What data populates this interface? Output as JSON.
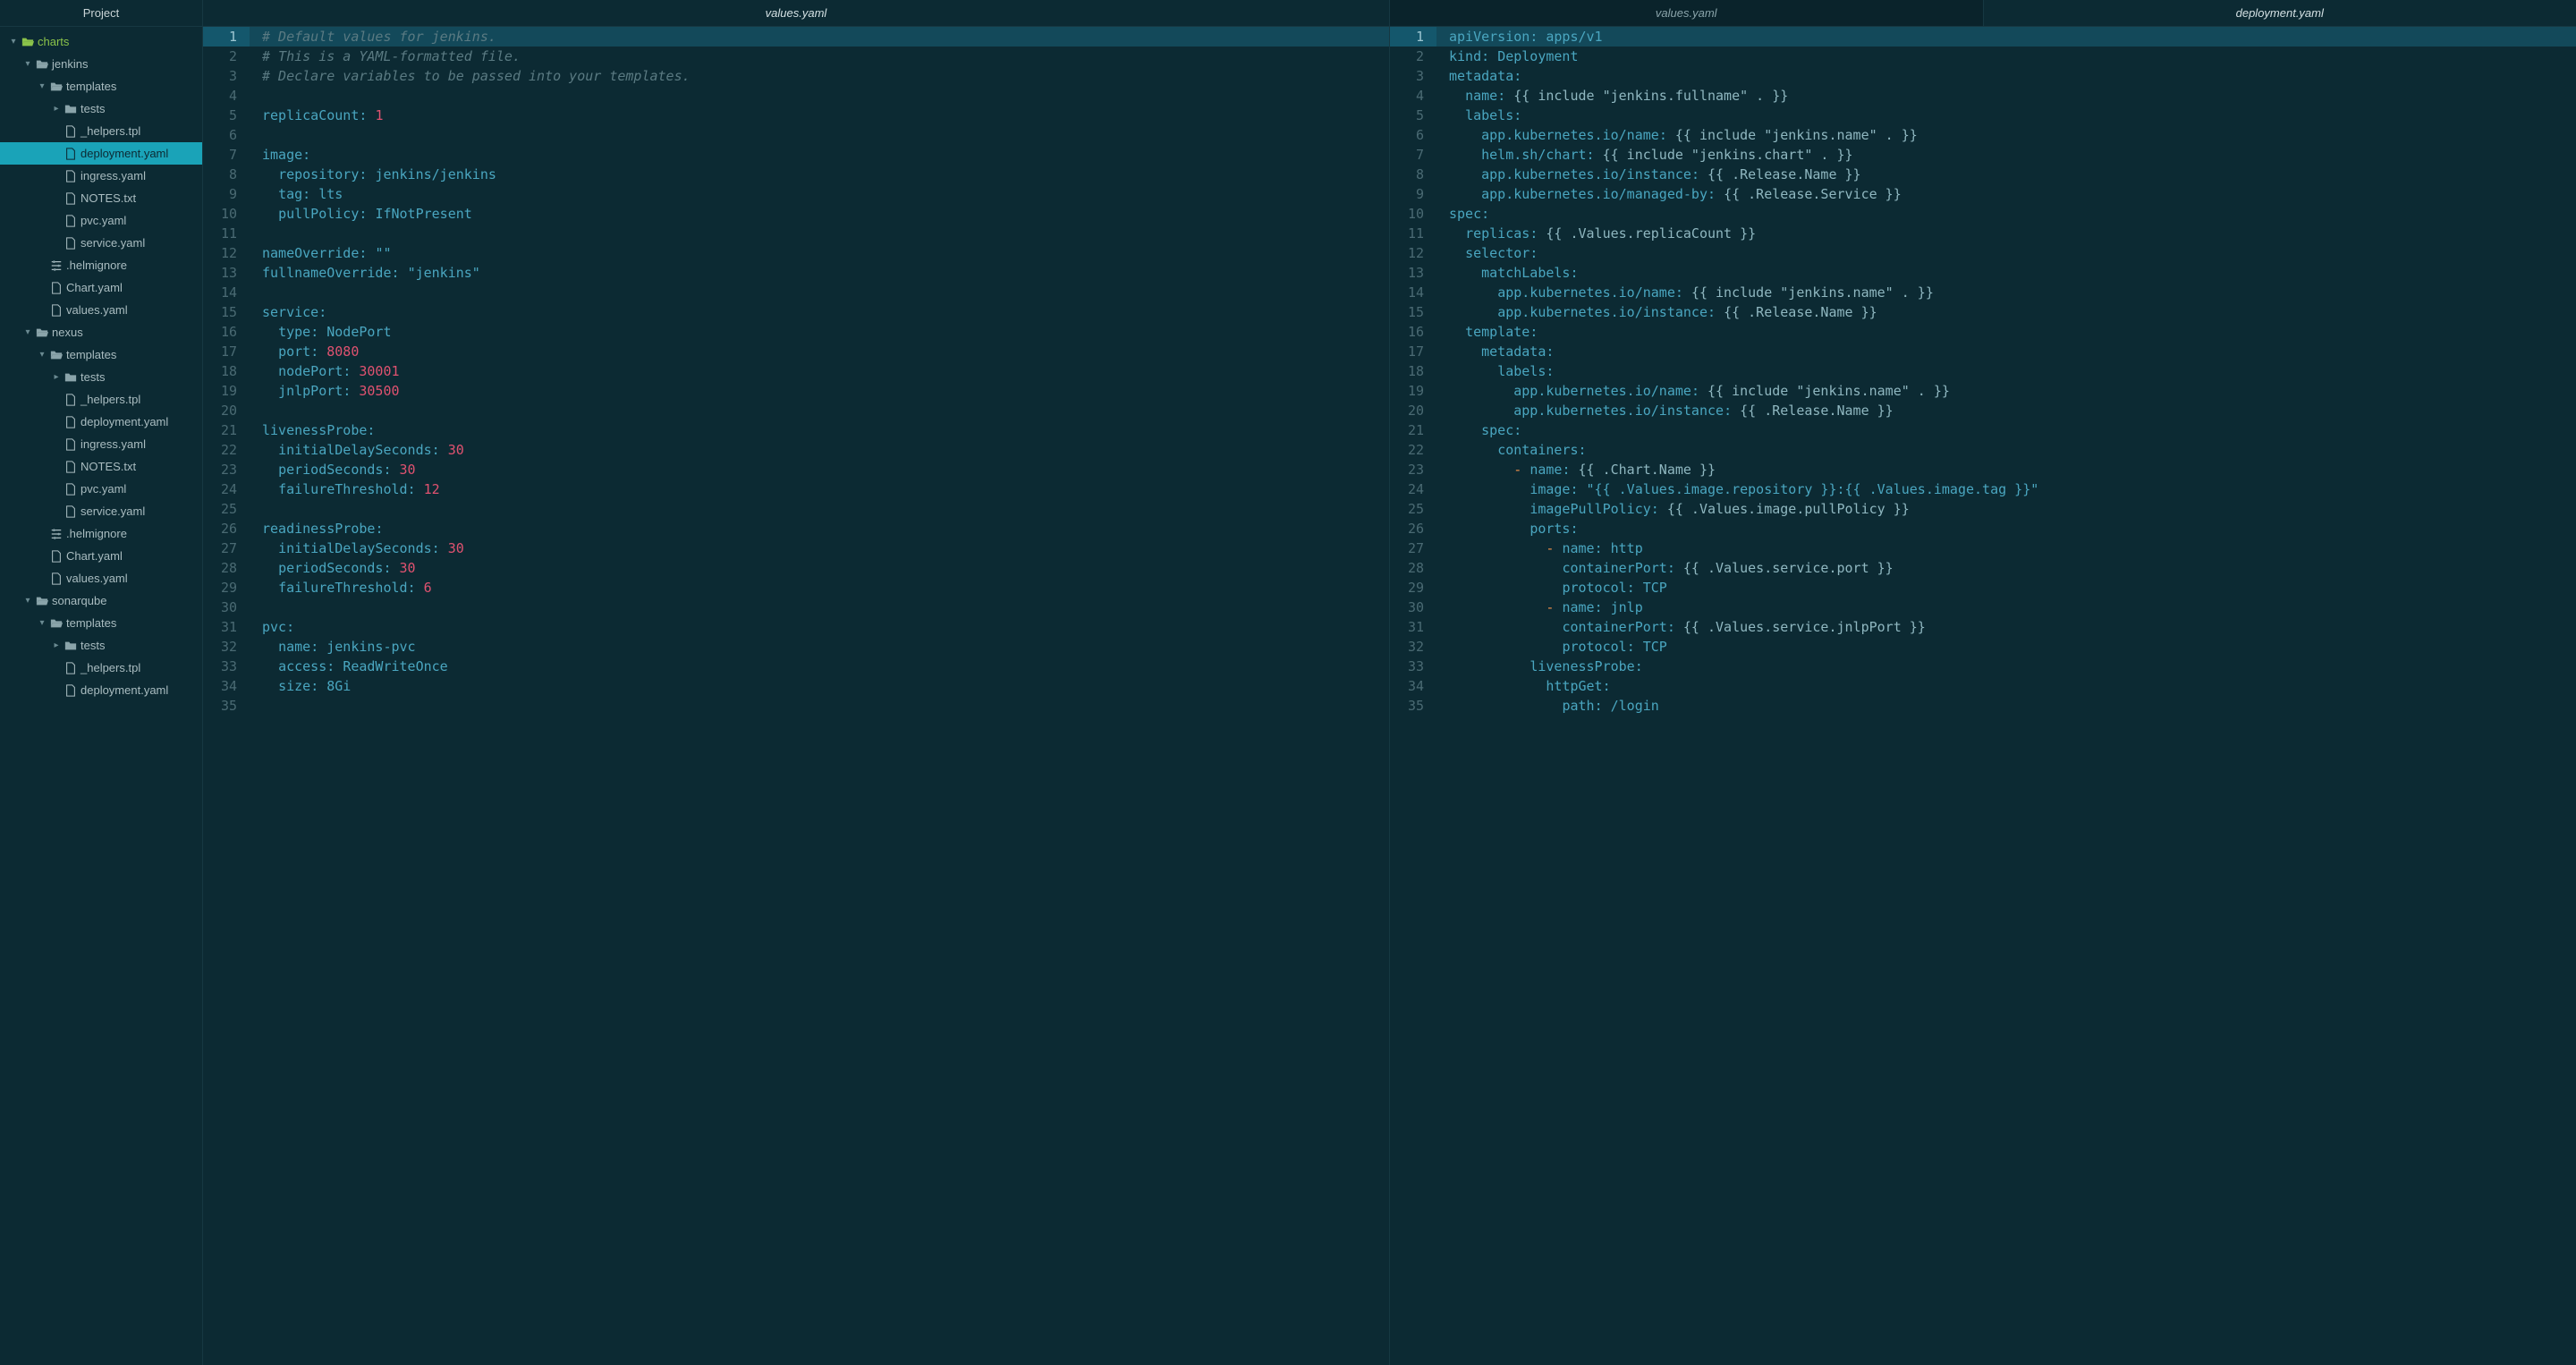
{
  "sidebar": {
    "title": "Project",
    "tree": [
      {
        "depth": 0,
        "arrow": "down",
        "icon": "folder-open",
        "iconColor": "green",
        "label": "charts",
        "top": true
      },
      {
        "depth": 1,
        "arrow": "down",
        "icon": "folder-open",
        "label": "jenkins"
      },
      {
        "depth": 2,
        "arrow": "down",
        "icon": "folder-open",
        "label": "templates"
      },
      {
        "depth": 3,
        "arrow": "right",
        "icon": "folder",
        "label": "tests"
      },
      {
        "depth": 3,
        "arrow": "",
        "icon": "file",
        "label": "_helpers.tpl"
      },
      {
        "depth": 3,
        "arrow": "",
        "icon": "file",
        "label": "deployment.yaml",
        "selected": true
      },
      {
        "depth": 3,
        "arrow": "",
        "icon": "file",
        "label": "ingress.yaml"
      },
      {
        "depth": 3,
        "arrow": "",
        "icon": "file",
        "label": "NOTES.txt"
      },
      {
        "depth": 3,
        "arrow": "",
        "icon": "file",
        "label": "pvc.yaml"
      },
      {
        "depth": 3,
        "arrow": "",
        "icon": "file",
        "label": "service.yaml"
      },
      {
        "depth": 2,
        "arrow": "",
        "icon": "sliders",
        "label": ".helmignore"
      },
      {
        "depth": 2,
        "arrow": "",
        "icon": "file",
        "label": "Chart.yaml"
      },
      {
        "depth": 2,
        "arrow": "",
        "icon": "file",
        "label": "values.yaml"
      },
      {
        "depth": 1,
        "arrow": "down",
        "icon": "folder-open",
        "label": "nexus"
      },
      {
        "depth": 2,
        "arrow": "down",
        "icon": "folder-open",
        "label": "templates"
      },
      {
        "depth": 3,
        "arrow": "right",
        "icon": "folder",
        "label": "tests"
      },
      {
        "depth": 3,
        "arrow": "",
        "icon": "file",
        "label": "_helpers.tpl"
      },
      {
        "depth": 3,
        "arrow": "",
        "icon": "file",
        "label": "deployment.yaml"
      },
      {
        "depth": 3,
        "arrow": "",
        "icon": "file",
        "label": "ingress.yaml"
      },
      {
        "depth": 3,
        "arrow": "",
        "icon": "file",
        "label": "NOTES.txt"
      },
      {
        "depth": 3,
        "arrow": "",
        "icon": "file",
        "label": "pvc.yaml"
      },
      {
        "depth": 3,
        "arrow": "",
        "icon": "file",
        "label": "service.yaml"
      },
      {
        "depth": 2,
        "arrow": "",
        "icon": "sliders",
        "label": ".helmignore"
      },
      {
        "depth": 2,
        "arrow": "",
        "icon": "file",
        "label": "Chart.yaml"
      },
      {
        "depth": 2,
        "arrow": "",
        "icon": "file",
        "label": "values.yaml"
      },
      {
        "depth": 1,
        "arrow": "down",
        "icon": "folder-open",
        "label": "sonarqube"
      },
      {
        "depth": 2,
        "arrow": "down",
        "icon": "folder-open",
        "label": "templates"
      },
      {
        "depth": 3,
        "arrow": "right",
        "icon": "folder",
        "label": "tests"
      },
      {
        "depth": 3,
        "arrow": "",
        "icon": "file",
        "label": "_helpers.tpl"
      },
      {
        "depth": 3,
        "arrow": "",
        "icon": "file",
        "label": "deployment.yaml"
      }
    ]
  },
  "panes": [
    {
      "tabs": [
        {
          "label": "values.yaml",
          "active": true
        }
      ],
      "highlight": 1,
      "lines": [
        [
          [
            "comment",
            "# Default values for jenkins."
          ]
        ],
        [
          [
            "comment",
            "# This is a YAML-formatted file."
          ]
        ],
        [
          [
            "comment",
            "# Declare variables to be passed into your templates."
          ]
        ],
        [],
        [
          [
            "key",
            "replicaCount"
          ],
          [
            "punc",
            ": "
          ],
          [
            "num",
            "1"
          ]
        ],
        [],
        [
          [
            "key",
            "image"
          ],
          [
            "punc",
            ":"
          ]
        ],
        [
          [
            "plain",
            "  "
          ],
          [
            "key",
            "repository"
          ],
          [
            "punc",
            ": "
          ],
          [
            "str",
            "jenkins/jenkins"
          ]
        ],
        [
          [
            "plain",
            "  "
          ],
          [
            "key",
            "tag"
          ],
          [
            "punc",
            ": "
          ],
          [
            "str",
            "lts"
          ]
        ],
        [
          [
            "plain",
            "  "
          ],
          [
            "key",
            "pullPolicy"
          ],
          [
            "punc",
            ": "
          ],
          [
            "str",
            "IfNotPresent"
          ]
        ],
        [],
        [
          [
            "key",
            "nameOverride"
          ],
          [
            "punc",
            ": "
          ],
          [
            "str",
            "\"\""
          ]
        ],
        [
          [
            "key",
            "fullnameOverride"
          ],
          [
            "punc",
            ": "
          ],
          [
            "str",
            "\"jenkins\""
          ]
        ],
        [],
        [
          [
            "key",
            "service"
          ],
          [
            "punc",
            ":"
          ]
        ],
        [
          [
            "plain",
            "  "
          ],
          [
            "key",
            "type"
          ],
          [
            "punc",
            ": "
          ],
          [
            "str",
            "NodePort"
          ]
        ],
        [
          [
            "plain",
            "  "
          ],
          [
            "key",
            "port"
          ],
          [
            "punc",
            ": "
          ],
          [
            "num",
            "8080"
          ]
        ],
        [
          [
            "plain",
            "  "
          ],
          [
            "key",
            "nodePort"
          ],
          [
            "punc",
            ": "
          ],
          [
            "num",
            "30001"
          ]
        ],
        [
          [
            "plain",
            "  "
          ],
          [
            "key",
            "jnlpPort"
          ],
          [
            "punc",
            ": "
          ],
          [
            "num",
            "30500"
          ]
        ],
        [],
        [
          [
            "key",
            "livenessProbe"
          ],
          [
            "punc",
            ":"
          ]
        ],
        [
          [
            "plain",
            "  "
          ],
          [
            "key",
            "initialDelaySeconds"
          ],
          [
            "punc",
            ": "
          ],
          [
            "num",
            "30"
          ]
        ],
        [
          [
            "plain",
            "  "
          ],
          [
            "key",
            "periodSeconds"
          ],
          [
            "punc",
            ": "
          ],
          [
            "num",
            "30"
          ]
        ],
        [
          [
            "plain",
            "  "
          ],
          [
            "key",
            "failureThreshold"
          ],
          [
            "punc",
            ": "
          ],
          [
            "num",
            "12"
          ]
        ],
        [],
        [
          [
            "key",
            "readinessProbe"
          ],
          [
            "punc",
            ":"
          ]
        ],
        [
          [
            "plain",
            "  "
          ],
          [
            "key",
            "initialDelaySeconds"
          ],
          [
            "punc",
            ": "
          ],
          [
            "num",
            "30"
          ]
        ],
        [
          [
            "plain",
            "  "
          ],
          [
            "key",
            "periodSeconds"
          ],
          [
            "punc",
            ": "
          ],
          [
            "num",
            "30"
          ]
        ],
        [
          [
            "plain",
            "  "
          ],
          [
            "key",
            "failureThreshold"
          ],
          [
            "punc",
            ": "
          ],
          [
            "num",
            "6"
          ]
        ],
        [],
        [
          [
            "key",
            "pvc"
          ],
          [
            "punc",
            ":"
          ]
        ],
        [
          [
            "plain",
            "  "
          ],
          [
            "key",
            "name"
          ],
          [
            "punc",
            ": "
          ],
          [
            "str",
            "jenkins-pvc"
          ]
        ],
        [
          [
            "plain",
            "  "
          ],
          [
            "key",
            "access"
          ],
          [
            "punc",
            ": "
          ],
          [
            "str",
            "ReadWriteOnce"
          ]
        ],
        [
          [
            "plain",
            "  "
          ],
          [
            "key",
            "size"
          ],
          [
            "punc",
            ": "
          ],
          [
            "str",
            "8Gi"
          ]
        ],
        []
      ]
    },
    {
      "tabs": [
        {
          "label": "values.yaml",
          "active": false
        },
        {
          "label": "deployment.yaml",
          "active": true
        }
      ],
      "highlight": 1,
      "lines": [
        [
          [
            "key",
            "apiVersion"
          ],
          [
            "punc",
            ": "
          ],
          [
            "str",
            "apps/v1"
          ]
        ],
        [
          [
            "key",
            "kind"
          ],
          [
            "punc",
            ": "
          ],
          [
            "str",
            "Deployment"
          ]
        ],
        [
          [
            "key",
            "metadata"
          ],
          [
            "punc",
            ":"
          ]
        ],
        [
          [
            "plain",
            "  "
          ],
          [
            "key",
            "name"
          ],
          [
            "punc",
            ": "
          ],
          [
            "plain",
            "{{ include \"jenkins.fullname\" . }}"
          ]
        ],
        [
          [
            "plain",
            "  "
          ],
          [
            "key",
            "labels"
          ],
          [
            "punc",
            ":"
          ]
        ],
        [
          [
            "plain",
            "    "
          ],
          [
            "key",
            "app.kubernetes.io/name"
          ],
          [
            "punc",
            ": "
          ],
          [
            "plain",
            "{{ include \"jenkins.name\" . }}"
          ]
        ],
        [
          [
            "plain",
            "    "
          ],
          [
            "key",
            "helm.sh/chart"
          ],
          [
            "punc",
            ": "
          ],
          [
            "plain",
            "{{ include \"jenkins.chart\" . }}"
          ]
        ],
        [
          [
            "plain",
            "    "
          ],
          [
            "key",
            "app.kubernetes.io/instance"
          ],
          [
            "punc",
            ": "
          ],
          [
            "plain",
            "{{ .Release.Name }}"
          ]
        ],
        [
          [
            "plain",
            "    "
          ],
          [
            "key",
            "app.kubernetes.io/managed-by"
          ],
          [
            "punc",
            ": "
          ],
          [
            "plain",
            "{{ .Release.Service }}"
          ]
        ],
        [
          [
            "key",
            "spec"
          ],
          [
            "punc",
            ":"
          ]
        ],
        [
          [
            "plain",
            "  "
          ],
          [
            "key",
            "replicas"
          ],
          [
            "punc",
            ": "
          ],
          [
            "plain",
            "{{ .Values.replicaCount }}"
          ]
        ],
        [
          [
            "plain",
            "  "
          ],
          [
            "key",
            "selector"
          ],
          [
            "punc",
            ":"
          ]
        ],
        [
          [
            "plain",
            "    "
          ],
          [
            "key",
            "matchLabels"
          ],
          [
            "punc",
            ":"
          ]
        ],
        [
          [
            "plain",
            "      "
          ],
          [
            "key",
            "app.kubernetes.io/name"
          ],
          [
            "punc",
            ": "
          ],
          [
            "plain",
            "{{ include \"jenkins.name\" . }}"
          ]
        ],
        [
          [
            "plain",
            "      "
          ],
          [
            "key",
            "app.kubernetes.io/instance"
          ],
          [
            "punc",
            ": "
          ],
          [
            "plain",
            "{{ .Release.Name }}"
          ]
        ],
        [
          [
            "plain",
            "  "
          ],
          [
            "key",
            "template"
          ],
          [
            "punc",
            ":"
          ]
        ],
        [
          [
            "plain",
            "    "
          ],
          [
            "key",
            "metadata"
          ],
          [
            "punc",
            ":"
          ]
        ],
        [
          [
            "plain",
            "      "
          ],
          [
            "key",
            "labels"
          ],
          [
            "punc",
            ":"
          ]
        ],
        [
          [
            "plain",
            "        "
          ],
          [
            "key",
            "app.kubernetes.io/name"
          ],
          [
            "punc",
            ": "
          ],
          [
            "plain",
            "{{ include \"jenkins.name\" . }}"
          ]
        ],
        [
          [
            "plain",
            "        "
          ],
          [
            "key",
            "app.kubernetes.io/instance"
          ],
          [
            "punc",
            ": "
          ],
          [
            "plain",
            "{{ .Release.Name }}"
          ]
        ],
        [
          [
            "plain",
            "    "
          ],
          [
            "key",
            "spec"
          ],
          [
            "punc",
            ":"
          ]
        ],
        [
          [
            "plain",
            "      "
          ],
          [
            "key",
            "containers"
          ],
          [
            "punc",
            ":"
          ]
        ],
        [
          [
            "plain",
            "        "
          ],
          [
            "dash",
            "- "
          ],
          [
            "key",
            "name"
          ],
          [
            "punc",
            ": "
          ],
          [
            "plain",
            "{{ .Chart.Name }}"
          ]
        ],
        [
          [
            "plain",
            "          "
          ],
          [
            "key",
            "image"
          ],
          [
            "punc",
            ": "
          ],
          [
            "str",
            "\"{{ .Values.image.repository }}:{{ .Values.image.tag }}\""
          ]
        ],
        [
          [
            "plain",
            "          "
          ],
          [
            "key",
            "imagePullPolicy"
          ],
          [
            "punc",
            ": "
          ],
          [
            "plain",
            "{{ .Values.image.pullPolicy }}"
          ]
        ],
        [
          [
            "plain",
            "          "
          ],
          [
            "key",
            "ports"
          ],
          [
            "punc",
            ":"
          ]
        ],
        [
          [
            "plain",
            "            "
          ],
          [
            "dash",
            "- "
          ],
          [
            "key",
            "name"
          ],
          [
            "punc",
            ": "
          ],
          [
            "str",
            "http"
          ]
        ],
        [
          [
            "plain",
            "              "
          ],
          [
            "key",
            "containerPort"
          ],
          [
            "punc",
            ": "
          ],
          [
            "plain",
            "{{ .Values.service.port }}"
          ]
        ],
        [
          [
            "plain",
            "              "
          ],
          [
            "key",
            "protocol"
          ],
          [
            "punc",
            ": "
          ],
          [
            "str",
            "TCP"
          ]
        ],
        [
          [
            "plain",
            "            "
          ],
          [
            "dash",
            "- "
          ],
          [
            "key",
            "name"
          ],
          [
            "punc",
            ": "
          ],
          [
            "str",
            "jnlp"
          ]
        ],
        [
          [
            "plain",
            "              "
          ],
          [
            "key",
            "containerPort"
          ],
          [
            "punc",
            ": "
          ],
          [
            "plain",
            "{{ .Values.service.jnlpPort }}"
          ]
        ],
        [
          [
            "plain",
            "              "
          ],
          [
            "key",
            "protocol"
          ],
          [
            "punc",
            ": "
          ],
          [
            "str",
            "TCP"
          ]
        ],
        [
          [
            "plain",
            "          "
          ],
          [
            "key",
            "livenessProbe"
          ],
          [
            "punc",
            ":"
          ]
        ],
        [
          [
            "plain",
            "            "
          ],
          [
            "key",
            "httpGet"
          ],
          [
            "punc",
            ":"
          ]
        ],
        [
          [
            "plain",
            "              "
          ],
          [
            "key",
            "path"
          ],
          [
            "punc",
            ": "
          ],
          [
            "str",
            "/login"
          ]
        ]
      ]
    }
  ]
}
